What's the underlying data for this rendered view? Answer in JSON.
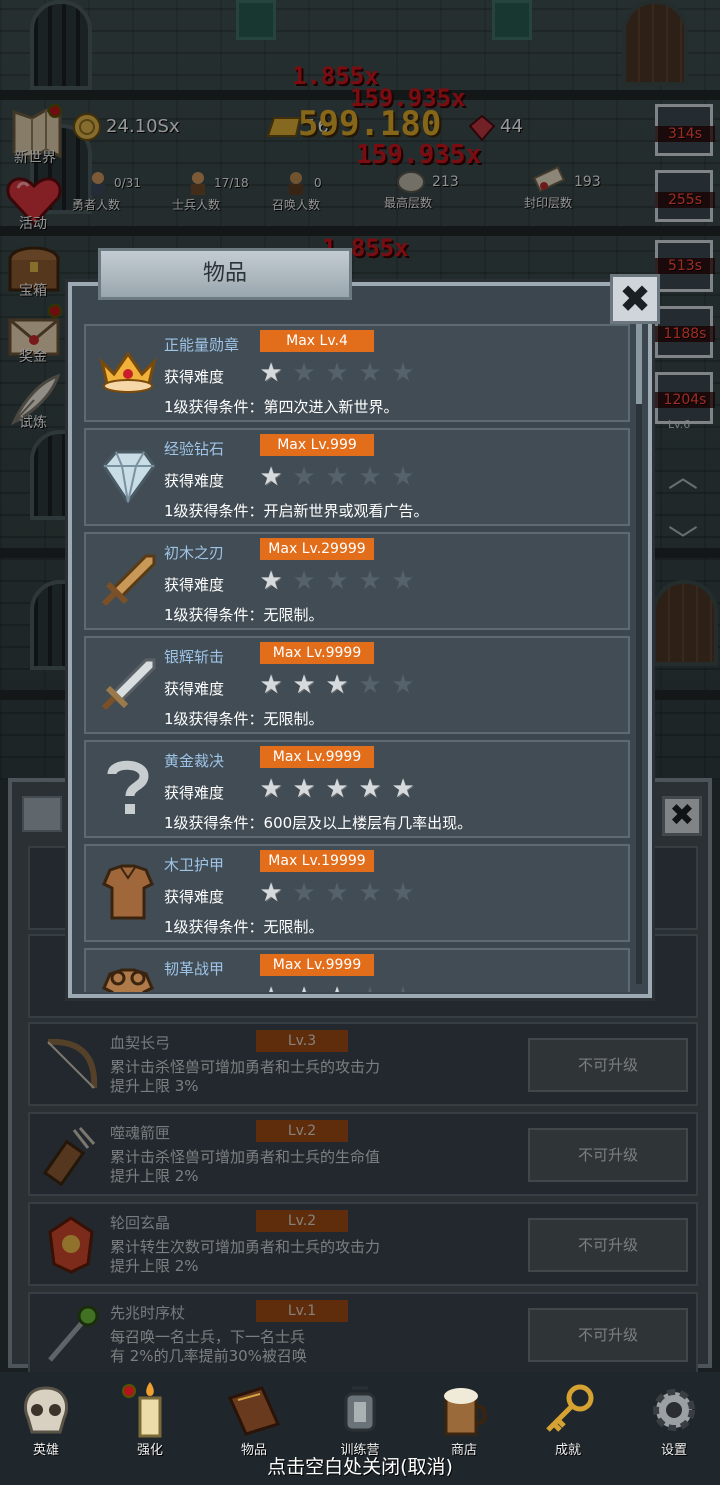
{
  "hud": {
    "side_menu": [
      {
        "label": "新世界",
        "icon": "map-scroll-icon",
        "badge": true
      },
      {
        "label": "活动",
        "icon": "heart-icon",
        "badge": false
      },
      {
        "label": "宝箱",
        "icon": "treasure-chest-icon",
        "badge": false
      },
      {
        "label": "奖金",
        "icon": "envelope-icon",
        "badge": true
      },
      {
        "label": "试炼",
        "icon": "quill-icon",
        "badge": false
      }
    ],
    "resources": {
      "gold": "24.10Sx",
      "bars": "16",
      "gems": "44"
    },
    "stats": [
      {
        "value": "0/31",
        "label": "勇者人数",
        "icon": "hero-icon"
      },
      {
        "value": "17/18",
        "label": "士兵人数",
        "icon": "soldier-icon"
      },
      {
        "value": "0",
        "label": "召唤人数",
        "icon": "summon-icon"
      },
      {
        "value": "213",
        "label": "最高层数",
        "icon": "stone-icon"
      },
      {
        "value": "193",
        "label": "封印层数",
        "icon": "sealed-scroll-icon"
      }
    ],
    "damage_numbers": [
      "1.855x",
      "159.935x",
      "599.180",
      "159.935x",
      "1.855x"
    ],
    "buff_timers": [
      "314s",
      "255s",
      "513s",
      "1188s",
      "1204s"
    ],
    "buff_sublabel": "Lv.6"
  },
  "modal": {
    "title": "物品",
    "close_glyph": "✖",
    "difficulty_label": "获得难度",
    "items": [
      {
        "name": "正能量勋章",
        "max": "Max Lv.4",
        "stars": 1,
        "condition": "1级获得条件：第四次进入新世界。",
        "icon": "crown-icon"
      },
      {
        "name": "经验钻石",
        "max": "Max Lv.999",
        "stars": 1,
        "condition": "1级获得条件：开启新世界或观看广告。",
        "icon": "diamond-icon"
      },
      {
        "name": "初木之刃",
        "max": "Max Lv.29999",
        "stars": 1,
        "condition": "1级获得条件：无限制。",
        "icon": "wooden-sword-icon"
      },
      {
        "name": "银辉斩击",
        "max": "Max Lv.9999",
        "stars": 3,
        "condition": "1级获得条件：无限制。",
        "icon": "silver-sword-icon"
      },
      {
        "name": "黄金裁决",
        "max": "Max Lv.9999",
        "stars": 5,
        "condition": "1级获得条件：600层及以上楼层有几率出现。",
        "icon": "question-mark-icon"
      },
      {
        "name": "木卫护甲",
        "max": "Max Lv.19999",
        "stars": 1,
        "condition": "1级获得条件：无限制。",
        "icon": "wooden-armor-icon"
      },
      {
        "name": "韧革战甲",
        "max": "Max Lv.9999",
        "stars": 3,
        "condition": "",
        "icon": "leather-armor-icon"
      }
    ]
  },
  "upgrades": {
    "button_label": "不可升级",
    "rows": [
      {
        "name": "血契长弓",
        "level": "Lv.3",
        "desc1": "累计击杀怪兽可增加勇者和士兵的攻击力",
        "desc2": "提升上限 3%",
        "icon": "longbow-icon"
      },
      {
        "name": "噬魂箭匣",
        "level": "Lv.2",
        "desc1": "累计击杀怪兽可增加勇者和士兵的生命值",
        "desc2": "提升上限 2%",
        "icon": "quiver-icon"
      },
      {
        "name": "轮回玄晶",
        "level": "Lv.2",
        "desc1": "累计转生次数可增加勇者和士兵的攻击力",
        "desc2": "提升上限 2%",
        "icon": "crystal-icon"
      },
      {
        "name": "先兆时序杖",
        "level": "Lv.1",
        "desc1": "每召唤一名士兵，下一名士兵",
        "desc2": "有 2%的几率提前30%被召唤",
        "icon": "staff-icon"
      }
    ]
  },
  "nav": [
    {
      "label": "英雄",
      "icon": "skull-icon",
      "badge": false
    },
    {
      "label": "强化",
      "icon": "candle-icon",
      "badge": true
    },
    {
      "label": "物品",
      "icon": "book-icon",
      "badge": false
    },
    {
      "label": "训练营",
      "icon": "lantern-icon",
      "badge": false
    },
    {
      "label": "商店",
      "icon": "mug-icon",
      "badge": false
    },
    {
      "label": "成就",
      "icon": "key-icon",
      "badge": false
    },
    {
      "label": "设置",
      "icon": "gear-icon",
      "badge": false
    }
  ],
  "close_hint": "点击空白处关闭(取消)",
  "colors": {
    "accent": "#e26e1c",
    "damage": "#c5161c",
    "item_name": "#9fc4e6",
    "panel": "#3c464e"
  }
}
